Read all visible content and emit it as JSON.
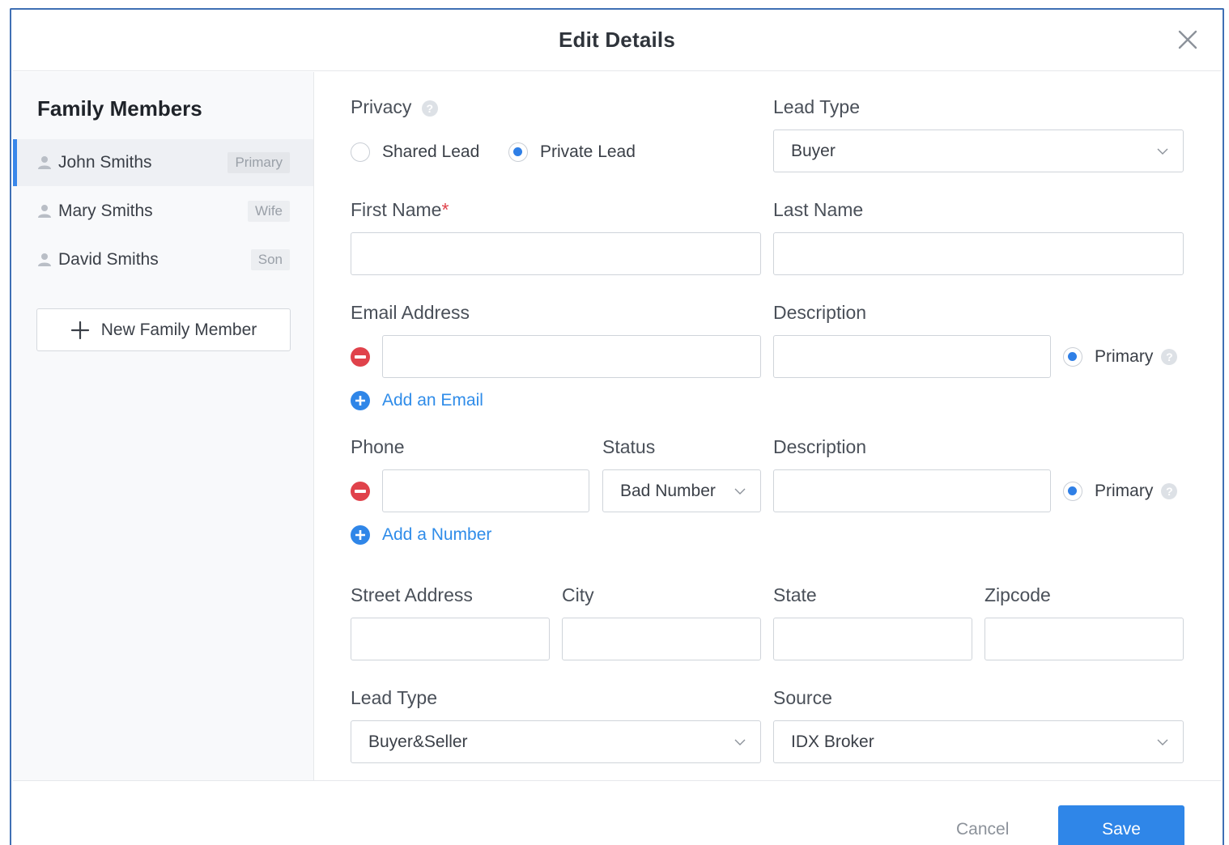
{
  "modal": {
    "title": "Edit Details"
  },
  "sidebar": {
    "title": "Family Members",
    "members": [
      {
        "name": "John Smiths",
        "tag": "Primary",
        "active": true
      },
      {
        "name": "Mary Smiths",
        "tag": "Wife",
        "active": false
      },
      {
        "name": "David Smiths",
        "tag": "Son",
        "active": false
      }
    ],
    "new_member_label": "New Family Member"
  },
  "form": {
    "privacy": {
      "label": "Privacy",
      "options": [
        {
          "label": "Shared Lead",
          "selected": false
        },
        {
          "label": "Private Lead",
          "selected": true
        }
      ]
    },
    "lead_type_top": {
      "label": "Lead Type",
      "value": "Buyer"
    },
    "first_name": {
      "label": "First Name",
      "required_mark": "*",
      "value": ""
    },
    "last_name": {
      "label": "Last Name",
      "value": ""
    },
    "email": {
      "label": "Email Address",
      "description_label": "Description",
      "value": "",
      "description": "",
      "primary_label": "Primary",
      "primary_selected": true,
      "add_label": "Add an Email"
    },
    "phone": {
      "label": "Phone",
      "status_label": "Status",
      "status_value": "Bad Number",
      "description_label": "Description",
      "value": "",
      "description": "",
      "primary_label": "Primary",
      "primary_selected": true,
      "add_label": "Add a Number"
    },
    "address": {
      "street_label": "Street Address",
      "city_label": "City",
      "state_label": "State",
      "zip_label": "Zipcode"
    },
    "lead_type_bottom": {
      "label": "Lead Type",
      "value": "Buyer&Seller"
    },
    "source": {
      "label": "Source",
      "value": "IDX Broker"
    }
  },
  "footer": {
    "cancel_label": "Cancel",
    "save_label": "Save"
  },
  "colors": {
    "accent": "#2f86e8",
    "danger": "#e0424b",
    "active_bar": "#3a87ea"
  }
}
